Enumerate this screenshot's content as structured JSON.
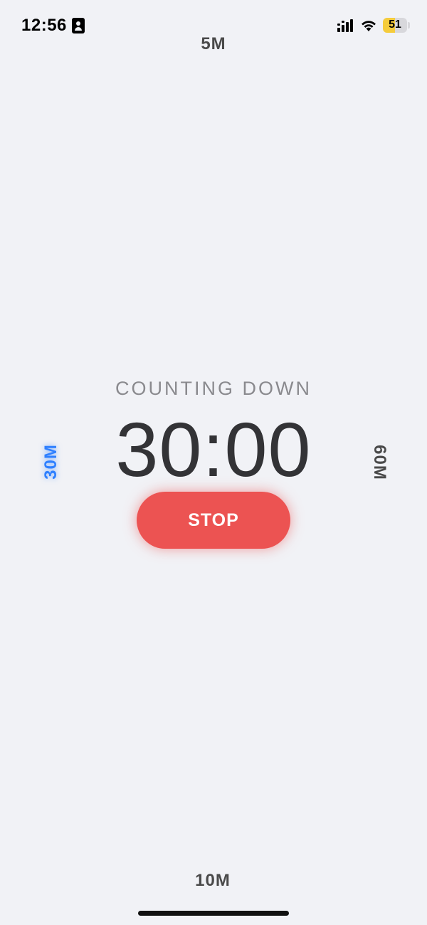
{
  "status_bar": {
    "time": "12:56",
    "battery_percent": "51",
    "battery_level": 0.51,
    "battery_color": "#f5cc3c"
  },
  "presets": {
    "top": "5M",
    "bottom": "10M",
    "left": "30M",
    "right": "60M",
    "selected": "30M",
    "selected_color": "#2f80ff"
  },
  "timer": {
    "status_label": "COUNTING DOWN",
    "display": "30:00"
  },
  "controls": {
    "stop_label": "STOP",
    "stop_color": "#ec5352"
  },
  "icons": [
    "contact-card-icon",
    "cellular-signal-icon",
    "wifi-icon",
    "battery-icon"
  ]
}
